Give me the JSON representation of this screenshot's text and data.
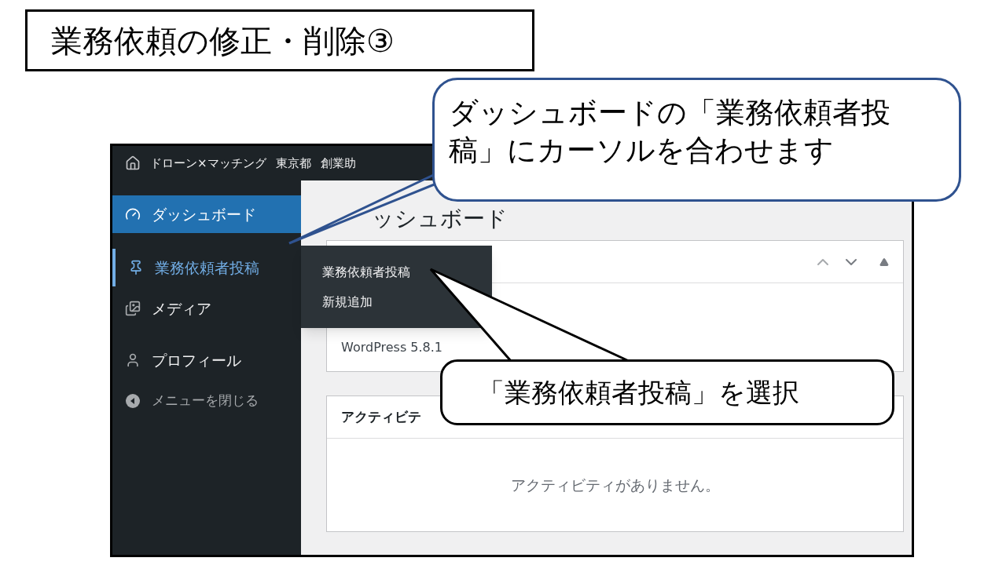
{
  "slide_title": "業務依頼の修正・削除③",
  "top_bar": {
    "site_name": "ドローン×マッチング",
    "items": [
      "東京都",
      "創業助"
    ]
  },
  "sidebar": {
    "items": [
      {
        "label": "ダッシュボード",
        "kind": "dashboard",
        "selected": true,
        "highlighted": false
      },
      {
        "label": "業務依頼者投稿",
        "kind": "pin",
        "selected": false,
        "highlighted": true
      },
      {
        "label": "メディア",
        "kind": "media",
        "selected": false,
        "highlighted": false
      },
      {
        "label": "プロフィール",
        "kind": "user",
        "selected": false,
        "highlighted": false
      },
      {
        "label": "メニューを閉じる",
        "kind": "collapse",
        "selected": false,
        "highlighted": false
      }
    ]
  },
  "flyout_menu": {
    "items": [
      {
        "label": "業務依頼者投稿",
        "selected": false
      },
      {
        "label": "新規追加",
        "selected": false
      }
    ]
  },
  "content": {
    "heading": "ッシュボード",
    "panels": [
      {
        "body": "WordPress 5.8.1",
        "kind": "info"
      },
      {
        "title": "アクティビテ",
        "body": "アクティビティがありません。",
        "kind": "empty"
      }
    ]
  },
  "callouts": [
    {
      "text": "ダッシュボードの「業務依頼者投稿」にカーソルを合わせます",
      "kind": "blue"
    },
    {
      "text": "「業務依頼者投稿」を選択",
      "kind": "black"
    }
  ]
}
